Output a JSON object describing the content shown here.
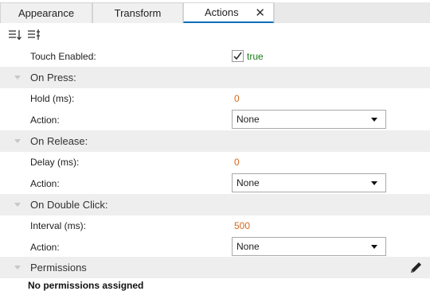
{
  "tabs": [
    {
      "label": "Appearance"
    },
    {
      "label": "Transform"
    },
    {
      "label": "Actions"
    }
  ],
  "active_tab": "Actions",
  "toolbar": {
    "icons": [
      "sort-ascending-icon",
      "sort-options-icon"
    ]
  },
  "properties": {
    "touch_enabled": {
      "label": "Touch Enabled:",
      "checked": true,
      "value_text": "true"
    },
    "on_press": {
      "title": "On Press:",
      "hold": {
        "label": "Hold (ms):",
        "value": "0"
      },
      "action": {
        "label": "Action:",
        "selected": "None"
      }
    },
    "on_release": {
      "title": "On Release:",
      "delay": {
        "label": "Delay (ms):",
        "value": "0"
      },
      "action": {
        "label": "Action:",
        "selected": "None"
      }
    },
    "on_double_click": {
      "title": "On Double Click:",
      "interval": {
        "label": "Interval (ms):",
        "value": "500"
      },
      "action": {
        "label": "Action:",
        "selected": "None"
      }
    },
    "permissions": {
      "title": "Permissions",
      "empty_text": "No permissions assigned"
    }
  },
  "colors": {
    "accent": "#0b6fb8",
    "number": "#d2691e",
    "true_text": "#1a7f1a",
    "section_bg": "#eeeeee"
  }
}
